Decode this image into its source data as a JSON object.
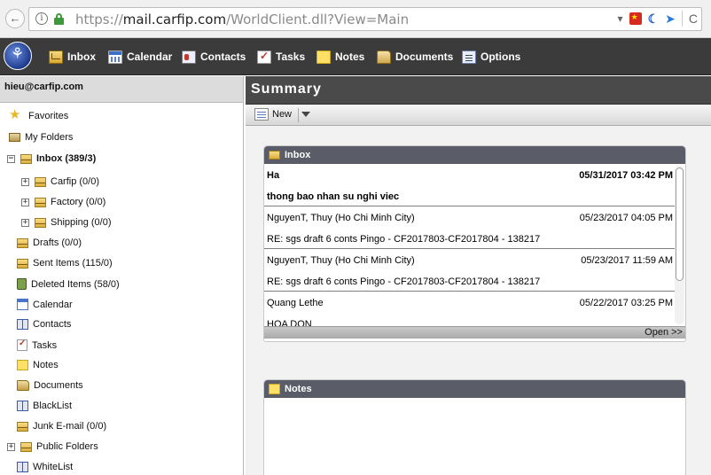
{
  "browser": {
    "url_scheme": "https://",
    "url_host": "mail.carfip.com",
    "url_path": "/WorldClient.dll?View=Main",
    "back_icon": "←",
    "info_icon": "i",
    "dropdown_icon": "▾",
    "reload_icon": "C"
  },
  "toolbar": {
    "items": [
      {
        "label": "Inbox",
        "icon": "inbox-icon"
      },
      {
        "label": "Calendar",
        "icon": "calendar-icon"
      },
      {
        "label": "Contacts",
        "icon": "contacts-icon"
      },
      {
        "label": "Tasks",
        "icon": "tasks-icon"
      },
      {
        "label": "Notes",
        "icon": "notes-icon"
      },
      {
        "label": "Documents",
        "icon": "documents-icon"
      },
      {
        "label": "Options",
        "icon": "options-icon"
      }
    ]
  },
  "sidebar": {
    "account": "hieu@carfip.com",
    "items": [
      {
        "label": "Favorites",
        "icon": "star-icon"
      },
      {
        "label": "My Folders",
        "icon": "folders-icon"
      },
      {
        "label": "Inbox (389/3)",
        "icon": "envelope-icon",
        "expander": "−"
      },
      {
        "label": "Carfip (0/0)",
        "icon": "envelope-icon",
        "expander": "+"
      },
      {
        "label": "Factory (0/0)",
        "icon": "envelope-icon",
        "expander": "+"
      },
      {
        "label": "Shipping (0/0)",
        "icon": "envelope-icon",
        "expander": "+"
      },
      {
        "label": "Drafts (0/0)",
        "icon": "envelope-icon"
      },
      {
        "label": "Sent Items (115/0)",
        "icon": "envelope-icon"
      },
      {
        "label": "Deleted Items (58/0)",
        "icon": "trash-icon"
      },
      {
        "label": "Calendar",
        "icon": "calendar-icon"
      },
      {
        "label": "Contacts",
        "icon": "address-book-icon"
      },
      {
        "label": "Tasks",
        "icon": "tasks-icon"
      },
      {
        "label": "Notes",
        "icon": "note-icon"
      },
      {
        "label": "Documents",
        "icon": "documents-icon"
      },
      {
        "label": "BlackList",
        "icon": "address-book-icon"
      },
      {
        "label": "Junk E-mail (0/0)",
        "icon": "envelope-icon"
      },
      {
        "label": "Public Folders",
        "icon": "envelope-icon",
        "expander": "+"
      },
      {
        "label": "WhiteList",
        "icon": "address-book-icon"
      }
    ]
  },
  "main": {
    "title": "Summary",
    "new_label": "New",
    "inbox_widget": {
      "title": "Inbox",
      "open_label": "Open >>",
      "messages": [
        {
          "from": "Ha",
          "date": "05/31/2017 03:42 PM",
          "subject": "thong bao nhan su nghi viec",
          "unread": true
        },
        {
          "from": "NguyenT, Thuy (Ho Chi Minh City)",
          "date": "05/23/2017 04:05 PM",
          "subject": "RE: sgs draft 6 conts Pingo - CF2017803-CF2017804 - 138217",
          "unread": false
        },
        {
          "from": "NguyenT, Thuy (Ho Chi Minh City)",
          "date": "05/23/2017 11:59 AM",
          "subject": "RE: sgs draft 6 conts Pingo - CF2017803-CF2017804 - 138217",
          "unread": false
        },
        {
          "from": "Quang Lethe",
          "date": "05/22/2017 03:25 PM",
          "subject": "HOA DON",
          "unread": false
        }
      ]
    },
    "notes_widget": {
      "title": "Notes"
    }
  }
}
